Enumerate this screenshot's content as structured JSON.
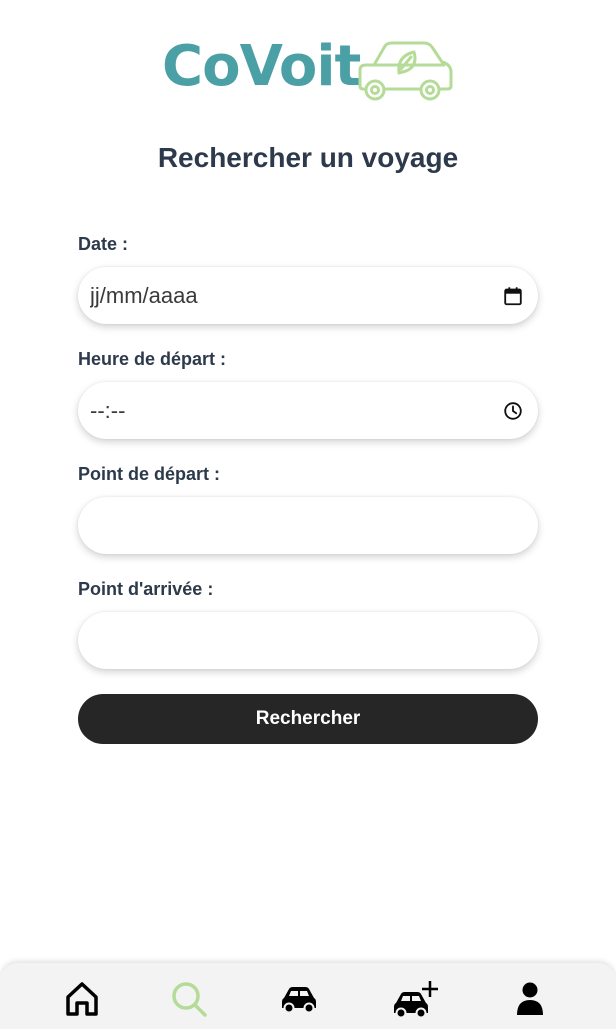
{
  "brand": {
    "name": "CoVoit",
    "text_color": "#4ba0a6",
    "car_color": "#b5db98"
  },
  "page": {
    "title": "Rechercher un voyage"
  },
  "form": {
    "date": {
      "label": "Date :",
      "placeholder": "jj/mm/aaaa",
      "icon": "calendar-icon"
    },
    "time": {
      "label": "Heure de départ :",
      "placeholder": "--:--",
      "icon": "clock-icon"
    },
    "departure": {
      "label": "Point de départ :",
      "value": ""
    },
    "arrival": {
      "label": "Point d'arrivée :",
      "value": ""
    },
    "submit_label": "Rechercher"
  },
  "nav": {
    "items": [
      {
        "name": "home",
        "icon": "home-icon",
        "active": false
      },
      {
        "name": "search",
        "icon": "search-icon",
        "active": true
      },
      {
        "name": "trips",
        "icon": "car-icon",
        "active": false
      },
      {
        "name": "add-trip",
        "icon": "car-plus-icon",
        "active": false
      },
      {
        "name": "profile",
        "icon": "user-icon",
        "active": false
      }
    ],
    "active_color": "#b5db98",
    "inactive_color": "#000000"
  },
  "colors": {
    "button_bg": "#262626",
    "text": "#2d3a4b"
  }
}
